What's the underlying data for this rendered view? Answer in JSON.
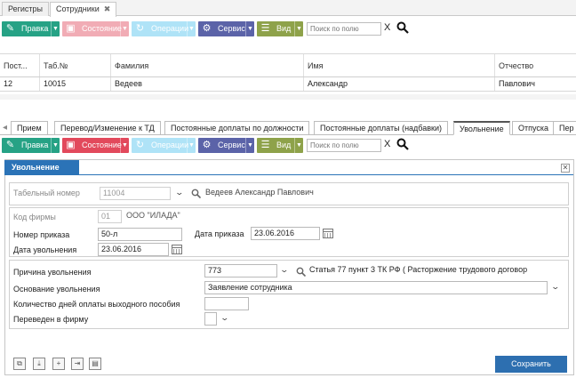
{
  "top_tabs": [
    {
      "label": "Регистры"
    },
    {
      "label": "Сотрудники"
    }
  ],
  "toolbar": {
    "pravka": "Правка",
    "sostoyanie": "Состояние",
    "operacii": "Операции",
    "servis": "Сервис",
    "vid": "Вид",
    "search_placeholder": "Поиск по полю",
    "clear": "X"
  },
  "grid": {
    "headers": [
      "Пост...",
      "Таб.№",
      "Фамилия",
      "Имя",
      "Отчество"
    ],
    "rows": [
      [
        "12",
        "10015",
        "Ведеев",
        "Александр",
        "Павлович"
      ]
    ]
  },
  "sub_tabs": [
    "Прием",
    "Перевод/Изменение к ТД",
    "Постоянные доплаты по должности",
    "Постоянные доплаты (надбавки)",
    "Увольнение",
    "Отпуска",
    "Пер"
  ],
  "form": {
    "title": "Увольнение",
    "tab_num_label": "Табельный номер",
    "tab_num_value": "11004",
    "employee_name": "Ведеев Александр Павлович",
    "firm_code_label": "Код фирмы",
    "firm_code_value": "01",
    "firm_name": "ООО \"ИЛАДА\"",
    "order_num_label": "Номер приказа",
    "order_num_value": "50-л",
    "order_date_label": "Дата приказа",
    "order_date_value": "23.06.2016",
    "dismiss_date_label": "Дата увольнения",
    "dismiss_date_value": "23.06.2016",
    "reason_label": "Причина увольнения",
    "reason_value": "773",
    "reason_text": "Статья 77 пункт 3 ТК РФ ( Расторжение трудового договор",
    "basis_label": "Основание увольнения",
    "basis_value": "Заявление сотрудника",
    "severance_label": "Количество дней оплаты выходного пособия",
    "severance_value": "",
    "transfer_label": "Переведен в фирму",
    "transfer_value": "",
    "save_label": "Сохранить"
  },
  "colors": {
    "pravka": "#26a285",
    "sostoyanie": "#e2495c",
    "operacii": "#4fc3ee",
    "servis": "#5b63a8",
    "vid": "#8ea24a",
    "accent": "#2b73b7"
  }
}
